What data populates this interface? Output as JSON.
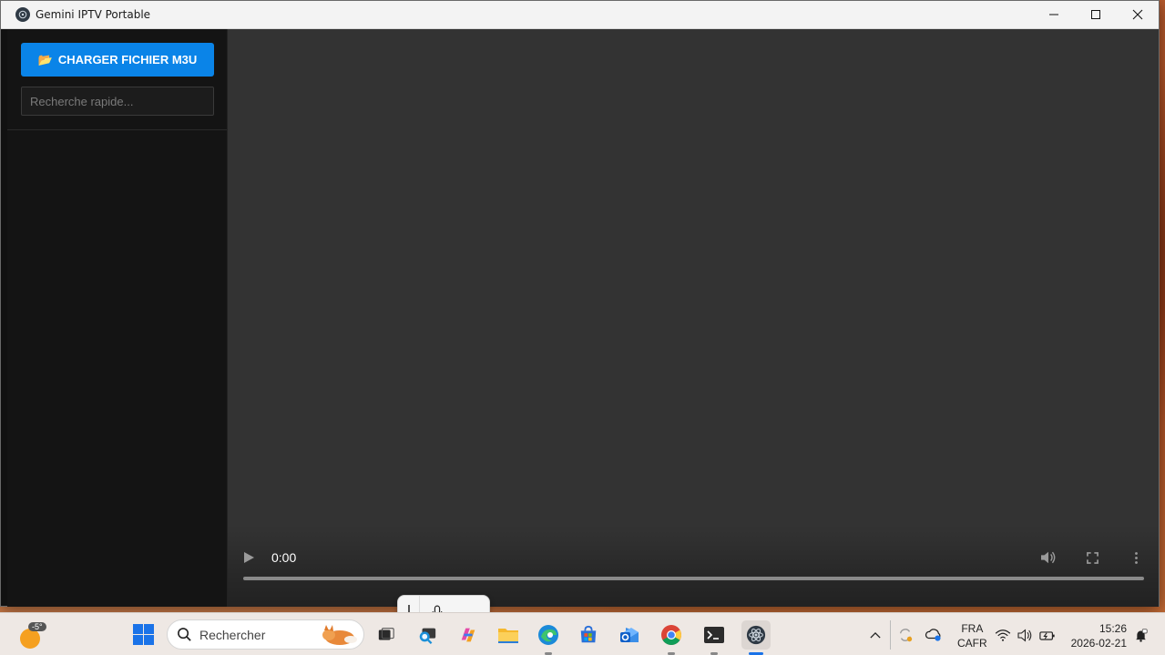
{
  "window": {
    "title": "Gemini IPTV Portable",
    "minimize_label": "Minimize",
    "maximize_label": "Maximize",
    "close_label": "Close"
  },
  "sidebar": {
    "load_button_label": "CHARGER FICHIER M3U",
    "load_button_icon": "folder-icon",
    "search_placeholder": "Recherche rapide..."
  },
  "player": {
    "current_time": "0:00",
    "progress": 0
  },
  "taskbar": {
    "weather_temp": "-5°",
    "search_label": "Rechercher",
    "language_line1": "FRA",
    "language_line2": "CAFR",
    "time": "15:26",
    "date": "2026-02-21"
  },
  "colors": {
    "accent": "#0a84e8",
    "player_bg": "#333333",
    "sidebar_bg": "#141414"
  }
}
